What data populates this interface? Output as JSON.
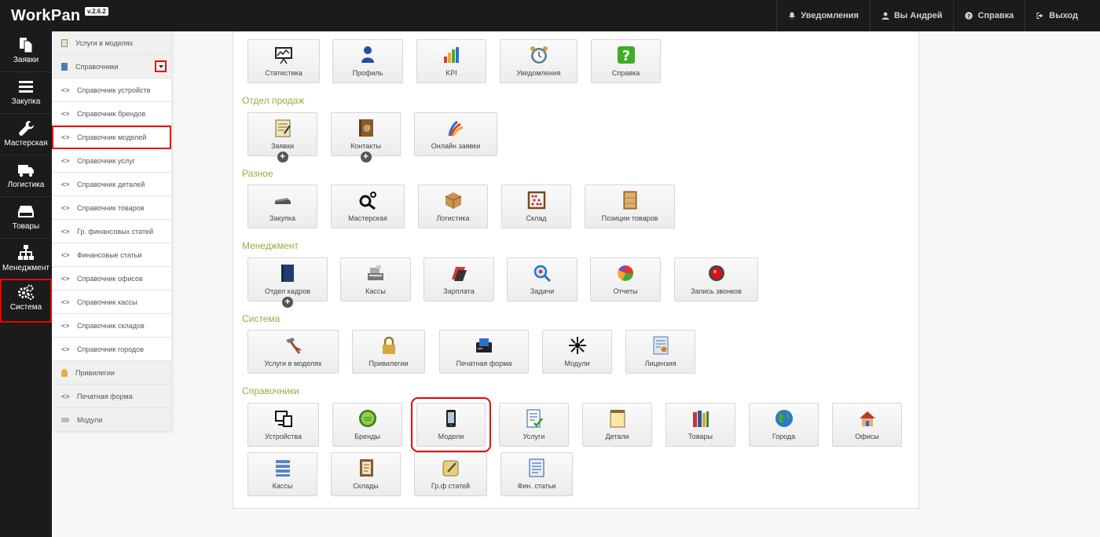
{
  "app": {
    "title": "WorkPan",
    "version": "v.2.6.2"
  },
  "topnav": [
    {
      "label": "Уведомления",
      "icon": "bell-icon"
    },
    {
      "label": "Вы Андрей",
      "icon": "user-icon"
    },
    {
      "label": "Справка",
      "icon": "question-icon"
    },
    {
      "label": "Выход",
      "icon": "logout-icon"
    }
  ],
  "leftnav": [
    {
      "label": "Заявки",
      "icon": "documents-icon"
    },
    {
      "label": "Закупка",
      "icon": "list-icon"
    },
    {
      "label": "Мастерская",
      "icon": "wrench-icon"
    },
    {
      "label": "Логистика",
      "icon": "truck-icon"
    },
    {
      "label": "Товары",
      "icon": "drive-icon"
    },
    {
      "label": "Менеджмент",
      "icon": "org-chart-icon"
    },
    {
      "label": "Система",
      "icon": "gears-icon",
      "active": true
    }
  ],
  "submenu": [
    {
      "label": "Услуги в моделях",
      "icon": "note-icon"
    },
    {
      "label": "Справочники",
      "icon": "book-icon"
    },
    {
      "label": "Справочник устройств",
      "icon": "code-icon"
    },
    {
      "label": "Справочник брендов",
      "icon": "code-icon"
    },
    {
      "label": "Справочник моделей",
      "icon": "code-icon"
    },
    {
      "label": "Справочник услуг",
      "icon": "code-icon"
    },
    {
      "label": "Справочник деталей",
      "icon": "code-icon"
    },
    {
      "label": "Справочник товаров",
      "icon": "code-icon"
    },
    {
      "label": "Гр. финансовых статей",
      "icon": "code-icon"
    },
    {
      "label": "Финансовые статьи",
      "icon": "code-icon"
    },
    {
      "label": "Справочник офисов",
      "icon": "code-icon"
    },
    {
      "label": "Справочник кассы",
      "icon": "code-icon"
    },
    {
      "label": "Справочник складов",
      "icon": "code-icon"
    },
    {
      "label": "Справочник городов",
      "icon": "code-icon"
    },
    {
      "label": "Привилегии",
      "icon": "key-icon"
    },
    {
      "label": "Печатная форма",
      "icon": "code-icon"
    },
    {
      "label": "Модули",
      "icon": "keyboard-icon"
    }
  ],
  "sections": {
    "top": {
      "tiles": [
        {
          "label": "Статистика",
          "icon": "presentation-icon"
        },
        {
          "label": "Профиль",
          "icon": "profile-icon"
        },
        {
          "label": "KPI",
          "icon": "kpi-chart-icon"
        },
        {
          "label": "Уведомления",
          "icon": "alarm-clock-icon"
        },
        {
          "label": "Справка",
          "icon": "help-icon"
        }
      ]
    },
    "sales": {
      "title": "Отдел продаж",
      "tiles": [
        {
          "label": "Заявки",
          "icon": "notepad-icon",
          "plus": true
        },
        {
          "label": "Контакты",
          "icon": "address-book-icon",
          "plus": true
        },
        {
          "label": "Онлайн заявки",
          "icon": "online-requests-icon"
        }
      ]
    },
    "misc": {
      "title": "Разное",
      "tiles": [
        {
          "label": "Закупка",
          "icon": "stapler-icon"
        },
        {
          "label": "Мастерская",
          "icon": "tools-icon"
        },
        {
          "label": "Логистика",
          "icon": "box-icon"
        },
        {
          "label": "Склад",
          "icon": "abacus-icon"
        },
        {
          "label": "Позиции товаров",
          "icon": "cabinet-icon"
        }
      ]
    },
    "management": {
      "title": "Менеджмент",
      "tiles": [
        {
          "label": "Отдел кадров",
          "icon": "book-dark-icon",
          "plus": true
        },
        {
          "label": "Кассы",
          "icon": "cash-register-icon"
        },
        {
          "label": "Зарплата",
          "icon": "salary-icon"
        },
        {
          "label": "Задачи",
          "icon": "tasks-icon"
        },
        {
          "label": "Отчеты",
          "icon": "pie-chart-icon"
        },
        {
          "label": "Запись звонков",
          "icon": "record-icon"
        }
      ]
    },
    "system": {
      "title": "Система",
      "tiles": [
        {
          "label": "Услуги в моделях",
          "icon": "hammer-icon"
        },
        {
          "label": "Привилегии",
          "icon": "lock-icon"
        },
        {
          "label": "Печатная форма",
          "icon": "card-reader-icon"
        },
        {
          "label": "Модули",
          "icon": "modules-icon"
        },
        {
          "label": "Лицензия",
          "icon": "certificate-icon"
        }
      ]
    },
    "directories": {
      "title": "Справочники",
      "tiles": [
        {
          "label": "Устройства",
          "icon": "devices-icon"
        },
        {
          "label": "Бренды",
          "icon": "green-button-icon"
        },
        {
          "label": "Модели",
          "icon": "phone-icon",
          "highlighted": true
        },
        {
          "label": "Услуги",
          "icon": "checklist-icon"
        },
        {
          "label": "Детали",
          "icon": "notepad-yellow-icon"
        },
        {
          "label": "Товары",
          "icon": "books-icon"
        },
        {
          "label": "Города",
          "icon": "globe-icon"
        },
        {
          "label": "Офисы",
          "icon": "house-icon"
        },
        {
          "label": "Кассы",
          "icon": "server-list-icon"
        },
        {
          "label": "Склады",
          "icon": "ledger-icon"
        },
        {
          "label": "Гр.ф статей",
          "icon": "folder-pen-icon"
        },
        {
          "label": "Фин. статьи",
          "icon": "document-icon"
        }
      ]
    }
  }
}
